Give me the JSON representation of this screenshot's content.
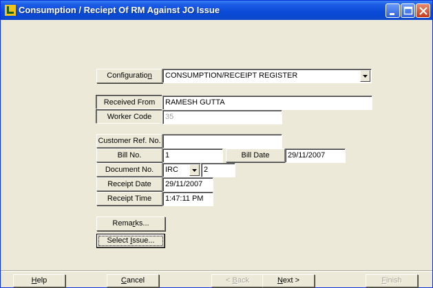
{
  "window": {
    "title": "Consumption / Reciept Of RM Against JO Issue",
    "buttons": [
      "minimize",
      "maximize",
      "close"
    ]
  },
  "form": {
    "configuration": {
      "label": "Configuration",
      "label_access": "n",
      "value": "CONSUMPTION/RECEIPT REGISTER"
    },
    "received_from": {
      "label": "Received From",
      "value": "RAMESH GUTTA"
    },
    "worker_code": {
      "label": "Worker Code",
      "value": "35"
    },
    "customer_ref": {
      "label": "Customer Ref. No.",
      "value": ""
    },
    "bill_no": {
      "label": "Bill No.",
      "value": "1"
    },
    "bill_date": {
      "label": "Bill Date",
      "value": "29/11/2007"
    },
    "document_no": {
      "label": "Document No.",
      "prefix": "IRC",
      "value": "2"
    },
    "receipt_date": {
      "label": "Receipt Date",
      "value": "29/11/2007"
    },
    "receipt_time": {
      "label": "Receipt Time",
      "value": "1:47:11 PM"
    },
    "remarks_button": {
      "pre": "Rema",
      "u": "r",
      "post": "ks..."
    },
    "select_issue_button": {
      "pre": "Select ",
      "u": "I",
      "post": "ssue..."
    }
  },
  "footer": {
    "help": {
      "pre": "",
      "u": "H",
      "post": "elp"
    },
    "cancel": {
      "pre": "",
      "u": "C",
      "post": "ancel"
    },
    "back": {
      "pre": "< ",
      "u": "B",
      "post": "ack"
    },
    "next": {
      "pre": "",
      "u": "N",
      "post": "ext >"
    },
    "finish": {
      "pre": "",
      "u": "F",
      "post": "inish"
    },
    "back_enabled": false,
    "finish_enabled": false
  }
}
